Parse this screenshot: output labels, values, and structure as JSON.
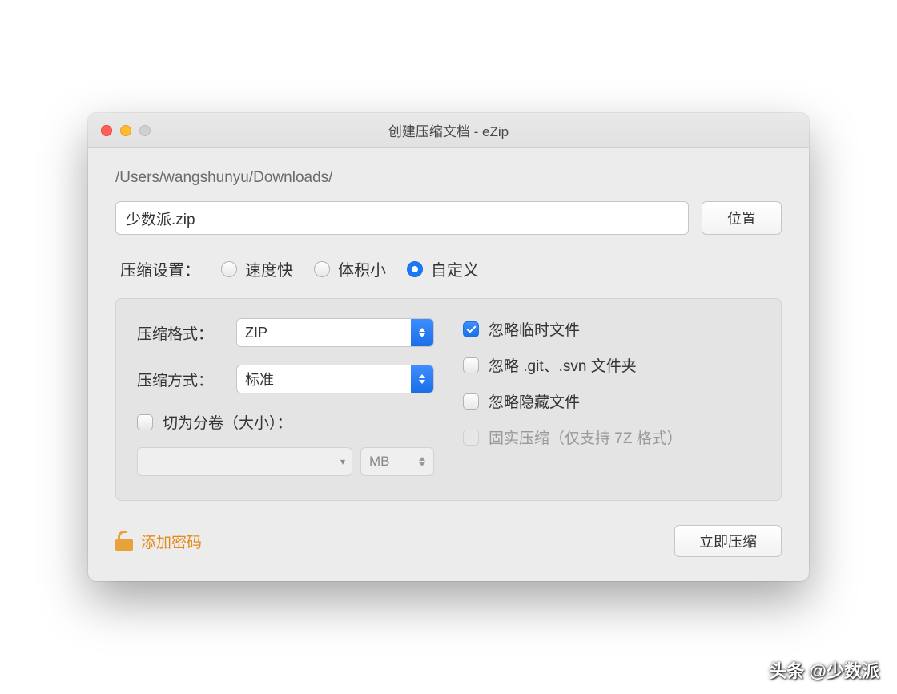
{
  "window": {
    "title": "创建压缩文档 - eZip",
    "path": "/Users/wangshunyu/Downloads/"
  },
  "file": {
    "name": "少数派.zip",
    "location_btn": "位置"
  },
  "settings": {
    "label": "压缩设置：",
    "radios": {
      "fast": "速度快",
      "small": "体积小",
      "custom": "自定义"
    }
  },
  "panel": {
    "format_label": "压缩格式：",
    "format_value": "ZIP",
    "method_label": "压缩方式：",
    "method_value": "标准",
    "split_label": "切为分卷（大小）：",
    "split_unit": "MB",
    "ignore_temp": "忽略临时文件",
    "ignore_git": "忽略 .git、.svn 文件夹",
    "ignore_hidden": "忽略隐藏文件",
    "solid": "固实压缩（仅支持 7Z 格式）"
  },
  "footer": {
    "add_password": "添加密码",
    "compress_now": "立即压缩"
  },
  "watermark": "头条 @少数派"
}
